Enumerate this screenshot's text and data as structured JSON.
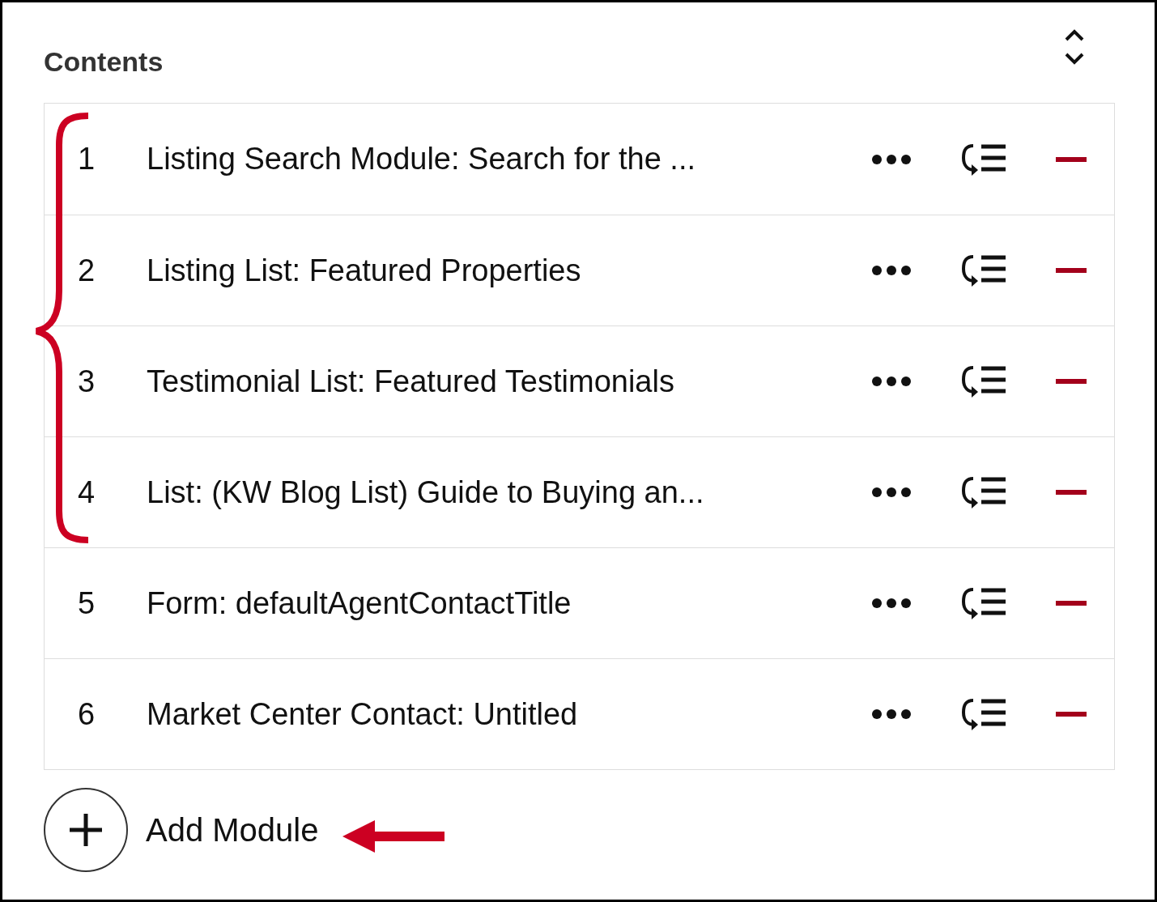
{
  "panel": {
    "title": "Contents"
  },
  "modules": [
    {
      "number": "1",
      "title": "Listing Search Module: Search for the ..."
    },
    {
      "number": "2",
      "title": "Listing List: Featured Properties"
    },
    {
      "number": "3",
      "title": "Testimonial List: Featured Testimonials"
    },
    {
      "number": "4",
      "title": "List: (KW Blog List) Guide to Buying an..."
    },
    {
      "number": "5",
      "title": "Form: defaultAgentContactTitle"
    },
    {
      "number": "6",
      "title": "Market Center Contact: Untitled"
    }
  ],
  "add_button": {
    "label": "Add Module"
  }
}
